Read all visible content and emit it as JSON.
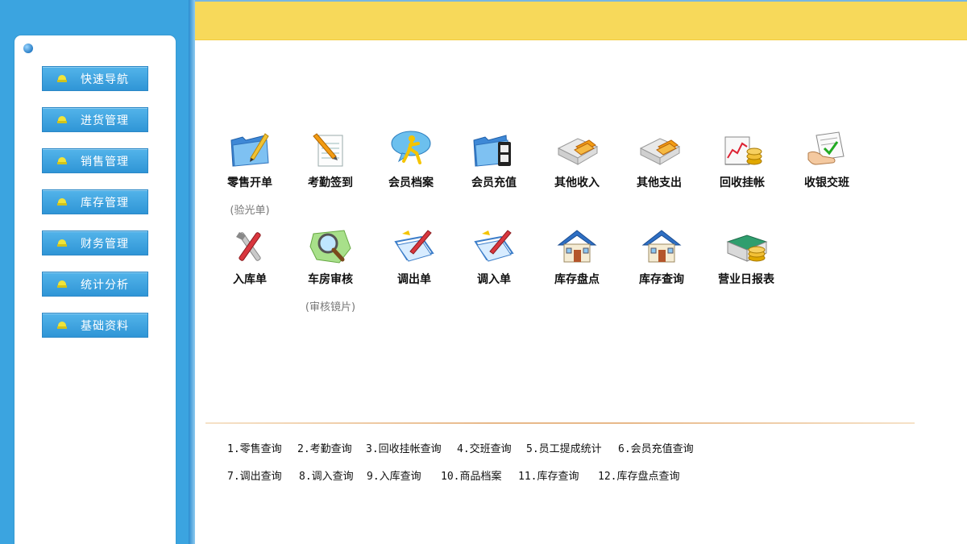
{
  "sidebar": {
    "items": [
      {
        "label": "快速导航"
      },
      {
        "label": "进货管理"
      },
      {
        "label": "销售管理"
      },
      {
        "label": "库存管理"
      },
      {
        "label": "财务管理"
      },
      {
        "label": "统计分析"
      },
      {
        "label": "基础资料"
      }
    ]
  },
  "icons": [
    {
      "label": "零售开单",
      "sub": "(验光单)",
      "icon": "folder-pen-icon"
    },
    {
      "label": "考勤签到",
      "icon": "notepad-pencil-icon"
    },
    {
      "label": "会员档案",
      "icon": "chat-person-icon"
    },
    {
      "label": "会员充值",
      "icon": "folder-film-icon"
    },
    {
      "label": "其他收入",
      "icon": "cash-box-icon"
    },
    {
      "label": "其他支出",
      "icon": "cash-box-icon"
    },
    {
      "label": "回收挂帐",
      "icon": "chart-coins-icon"
    },
    {
      "label": "收银交班",
      "icon": "hand-document-icon"
    },
    {
      "label": "入库单",
      "icon": "tools-icon"
    },
    {
      "label": "车房审核",
      "sub": "(审核镜片)",
      "icon": "magnifier-icon"
    },
    {
      "label": "调出单",
      "icon": "clipboard-pen-icon"
    },
    {
      "label": "调入单",
      "icon": "clipboard-pen-icon"
    },
    {
      "label": "库存盘点",
      "icon": "house-icon"
    },
    {
      "label": "库存查询",
      "icon": "house-icon"
    },
    {
      "label": "营业日报表",
      "icon": "cash-register-icon"
    }
  ],
  "quick_links": {
    "row1": [
      "1.零售查询",
      "2.考勤查询",
      "3.回收挂帐查询",
      "4.交班查询",
      "5.员工提成统计",
      "6.会员充值查询"
    ],
    "row2": [
      "7.调出查询",
      "8.调入查询",
      "9.入库查询",
      "10.商品档案",
      "11.库存查询",
      "12.库存盘点查询"
    ]
  },
  "colors": {
    "sidebar": "#3ba4e0",
    "topbar": "#f7d95a",
    "nav_button": "#3fa3de"
  }
}
